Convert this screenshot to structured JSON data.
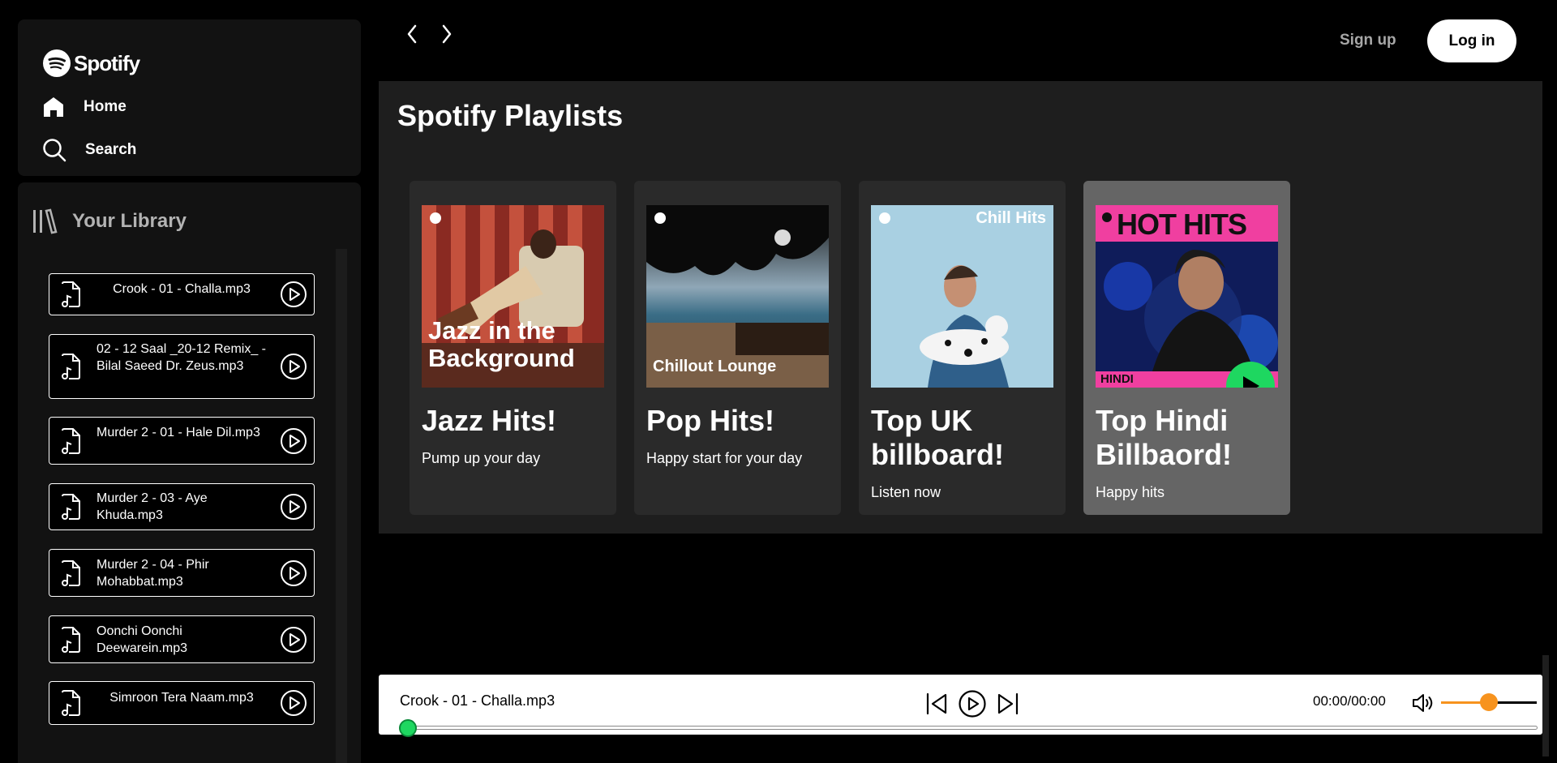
{
  "brand": {
    "name": "Spotify"
  },
  "nav": {
    "home": "Home",
    "search": "Search"
  },
  "library": {
    "title": "Your Library",
    "songs": [
      {
        "title": "Crook - 01 - Challa.mp3"
      },
      {
        "title": "02 - 12 Saal _20-12 Remix_ - Bilal Saeed Dr. Zeus.mp3"
      },
      {
        "title": "Murder 2 - 01 - Hale Dil.mp3"
      },
      {
        "title": "Murder 2 - 03 - Aye Khuda.mp3"
      },
      {
        "title": "Murder 2 - 04 - Phir Mohabbat.mp3"
      },
      {
        "title": "Oonchi Oonchi Deewarein.mp3"
      },
      {
        "title": "Simroon Tera Naam.mp3"
      }
    ]
  },
  "header": {
    "signup": "Sign up",
    "login": "Log in"
  },
  "main": {
    "title": "Spotify Playlists",
    "cards": [
      {
        "title": "Jazz Hits!",
        "desc": "Pump up your day",
        "cover_text": "Jazz in the Background"
      },
      {
        "title": "Pop Hits!",
        "desc": "Happy start for your day",
        "cover_text": "Chillout Lounge"
      },
      {
        "title": "Top UK billboard!",
        "desc": "Listen now",
        "cover_text": "Chill Hits"
      },
      {
        "title": "Top Hindi Billbaord!",
        "desc": "Happy hits",
        "cover_text": "HOT HITS",
        "cover_sub": "HINDI"
      }
    ]
  },
  "player": {
    "now_playing": "Crook - 01 - Challa.mp3",
    "time": "00:00/00:00",
    "progress": 0,
    "volume": 0.5
  },
  "colors": {
    "accent": "#1ed760",
    "volume": "#f7931e",
    "hover_card": "#656565"
  }
}
